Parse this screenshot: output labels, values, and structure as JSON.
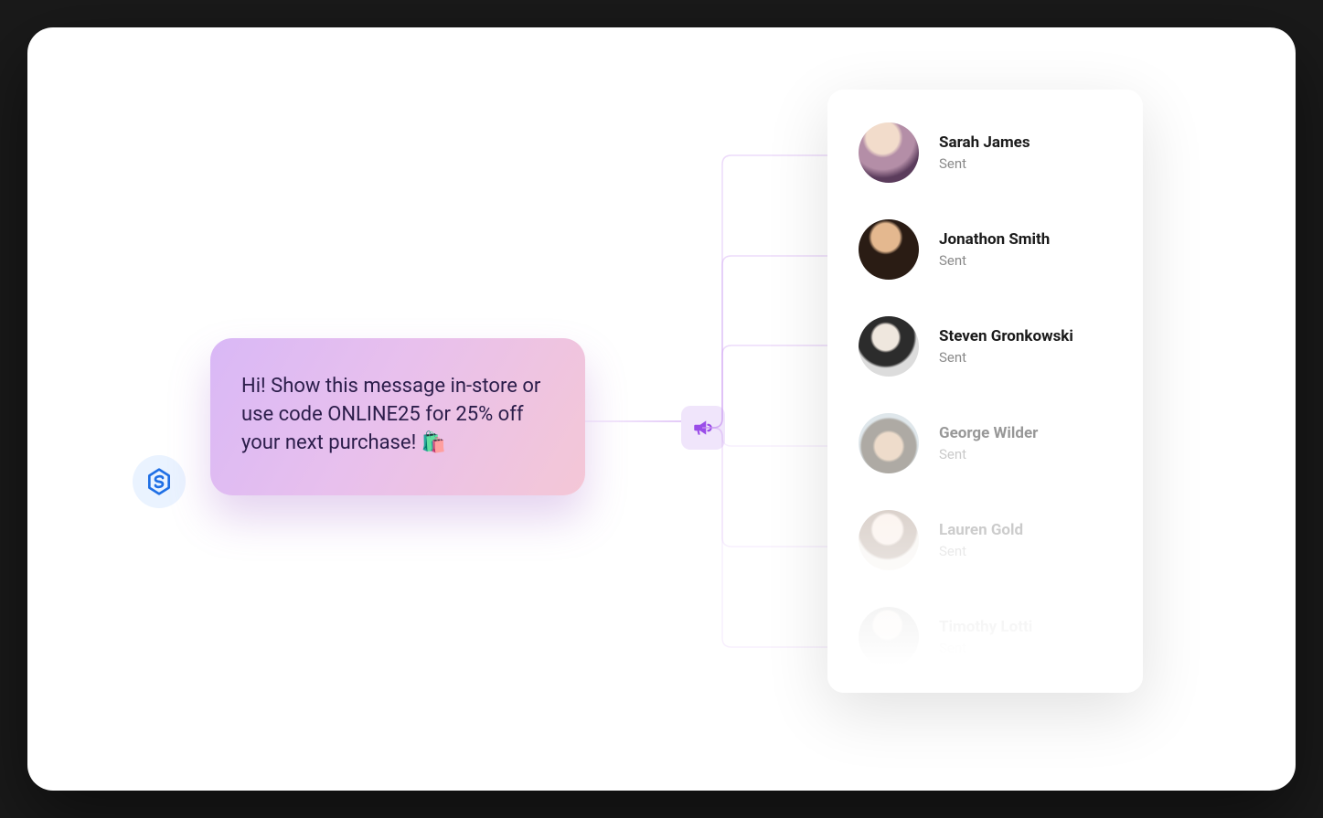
{
  "message": {
    "text": "Hi! Show this message in-store or use code ONLINE25 for 25% off your next purchase! 🛍️"
  },
  "recipients": [
    {
      "name": "Sarah James",
      "status": "Sent"
    },
    {
      "name": "Jonathon Smith",
      "status": "Sent"
    },
    {
      "name": "Steven Gronkowski",
      "status": "Sent"
    },
    {
      "name": "George Wilder",
      "status": "Sent"
    },
    {
      "name": "Lauren Gold",
      "status": "Sent"
    },
    {
      "name": "Timothy Lotti",
      "status": "Sent"
    }
  ],
  "colors": {
    "accent": "#a259ff",
    "bubble_start": "#d9b8f6",
    "bubble_end": "#f4c7d6"
  }
}
